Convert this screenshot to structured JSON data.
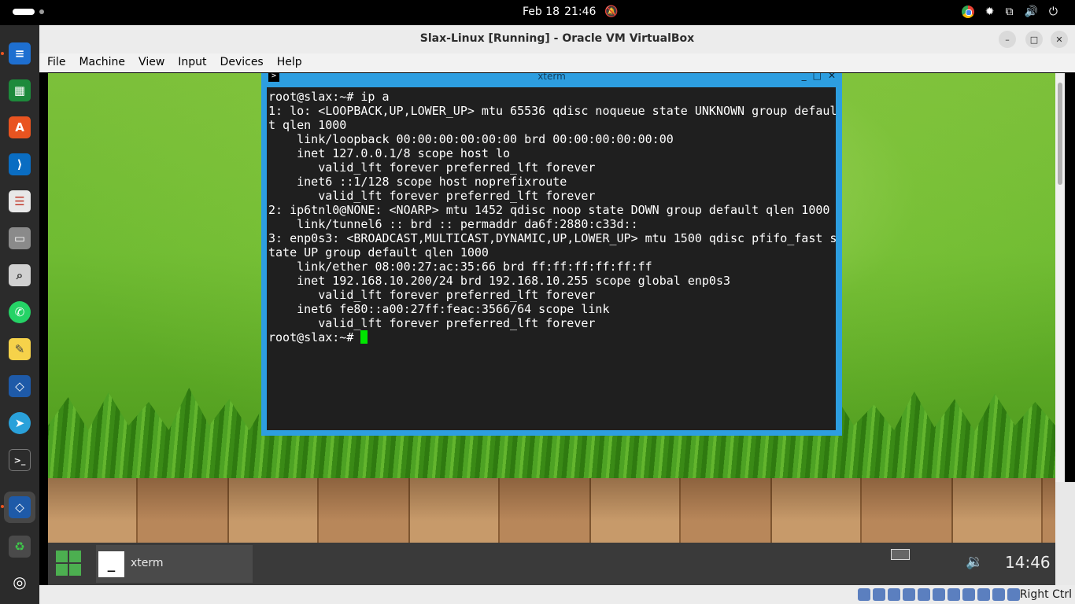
{
  "topbar": {
    "date": "Feb 18",
    "time": "21:46",
    "tray_icons": [
      "chrome-icon",
      "brightness-icon",
      "network-icon",
      "volume-icon",
      "power-icon"
    ]
  },
  "window": {
    "title": "Slax-Linux [Running] - Oracle VM VirtualBox",
    "minimize": "–",
    "maximize": "□",
    "close": "✕"
  },
  "menu": [
    "File",
    "Machine",
    "View",
    "Input",
    "Devices",
    "Help"
  ],
  "dock": [
    "text-editor",
    "spreadsheet",
    "app-center",
    "vscode",
    "reader",
    "files",
    "image-viewer",
    "whatsapp",
    "notes",
    "virtualbox",
    "telegram",
    "terminal",
    "virtualbox-active",
    "trash",
    "show-apps"
  ],
  "xterm": {
    "title": "xterm",
    "lines": [
      "root@slax:~# ip a",
      "1: lo: <LOOPBACK,UP,LOWER_UP> mtu 65536 qdisc noqueue state UNKNOWN group defaul",
      "t qlen 1000",
      "    link/loopback 00:00:00:00:00:00 brd 00:00:00:00:00:00",
      "    inet 127.0.0.1/8 scope host lo",
      "       valid_lft forever preferred_lft forever",
      "    inet6 ::1/128 scope host noprefixroute",
      "       valid_lft forever preferred_lft forever",
      "2: ip6tnl0@NONE: <NOARP> mtu 1452 qdisc noop state DOWN group default qlen 1000",
      "    link/tunnel6 :: brd :: permaddr da6f:2880:c33d::",
      "3: enp0s3: <BROADCAST,MULTICAST,DYNAMIC,UP,LOWER_UP> mtu 1500 qdisc pfifo_fast s",
      "tate UP group default qlen 1000",
      "    link/ether 08:00:27:ac:35:66 brd ff:ff:ff:ff:ff:ff",
      "    inet 192.168.10.200/24 brd 192.168.10.255 scope global enp0s3",
      "       valid_lft forever preferred_lft forever",
      "    inet6 fe80::a00:27ff:feac:3566/64 scope link",
      "       valid_lft forever preferred_lft forever"
    ],
    "prompt": "root@slax:~# "
  },
  "slax": {
    "task_label": "xterm",
    "task_icon": "_",
    "time": "14:46"
  },
  "status": {
    "host_key": "Right Ctrl"
  },
  "colors": {
    "cursor": "#00e600",
    "xterm_border": "#2d9ee0",
    "start_button": "#4caf50"
  }
}
